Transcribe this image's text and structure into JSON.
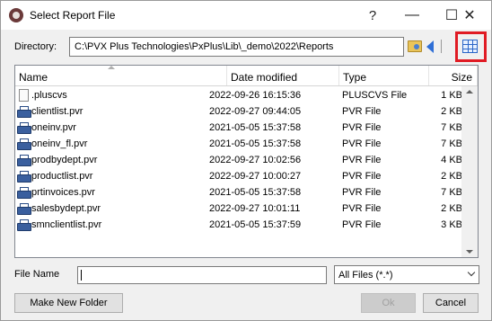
{
  "window": {
    "title": "Select Report File",
    "controls": {
      "help": "?",
      "minimize": "—",
      "maximize": "☐",
      "close": "✕"
    }
  },
  "directory": {
    "label": "Directory:",
    "path": "C:\\PVX Plus Technologies\\PxPlus\\Lib\\_demo\\2022\\Reports"
  },
  "toolbar": {
    "icons": [
      "open-folder-icon",
      "back-arrow-icon",
      "grid-view-icon"
    ],
    "highlight_color": "#e01b24"
  },
  "list": {
    "columns": [
      "Name",
      "Date modified",
      "Type",
      "Size"
    ],
    "rows": [
      {
        "icon": "file-icon",
        "name": ".pluscvs",
        "date": "2022-09-26 16:15:36",
        "type": "PLUSCVS File",
        "size": "1 KB"
      },
      {
        "icon": "printer-icon",
        "name": "clientlist.pvr",
        "date": "2022-09-27 09:44:05",
        "type": "PVR File",
        "size": "2 KB"
      },
      {
        "icon": "printer-icon",
        "name": "oneinv.pvr",
        "date": "2021-05-05 15:37:58",
        "type": "PVR File",
        "size": "7 KB"
      },
      {
        "icon": "printer-icon",
        "name": "oneinv_fl.pvr",
        "date": "2021-05-05 15:37:58",
        "type": "PVR File",
        "size": "7 KB"
      },
      {
        "icon": "printer-icon",
        "name": "prodbydept.pvr",
        "date": "2022-09-27 10:02:56",
        "type": "PVR File",
        "size": "4 KB"
      },
      {
        "icon": "printer-icon",
        "name": "productlist.pvr",
        "date": "2022-09-27 10:00:27",
        "type": "PVR File",
        "size": "2 KB"
      },
      {
        "icon": "printer-icon",
        "name": "prtinvoices.pvr",
        "date": "2021-05-05 15:37:58",
        "type": "PVR File",
        "size": "7 KB"
      },
      {
        "icon": "printer-icon",
        "name": "salesbydept.pvr",
        "date": "2022-09-27 10:01:11",
        "type": "PVR File",
        "size": "2 KB"
      },
      {
        "icon": "printer-icon",
        "name": "smnclientlist.pvr",
        "date": "2021-05-05 15:37:59",
        "type": "PVR File",
        "size": "3 KB"
      }
    ]
  },
  "file_name": {
    "label": "File Name",
    "value": ""
  },
  "filter": {
    "selected": "All Files (*.*)"
  },
  "buttons": {
    "new_folder": "Make New Folder",
    "ok": "Ok",
    "cancel": "Cancel"
  }
}
